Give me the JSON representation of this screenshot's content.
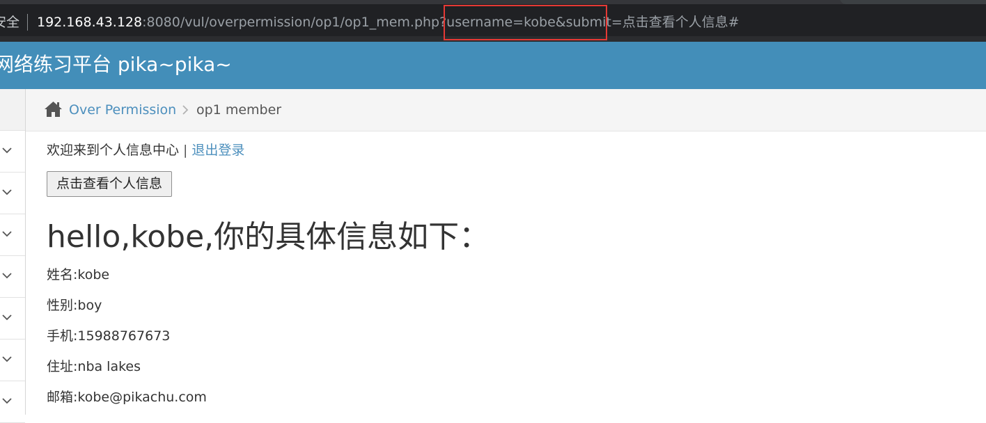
{
  "browser": {
    "security_label": "安全",
    "url_host": "192.168.43.128",
    "url_rest": ":8080/vul/overpermission/op1/op1_mem.php?username=kobe&submit=点击查看个人信息#",
    "highlight_color": "#e53935"
  },
  "header": {
    "brand": "网络练习平台 pika~pika~",
    "background": "#438eb9"
  },
  "sidebar": {
    "items": [
      {
        "icon": "chevron-down-icon"
      },
      {
        "icon": "chevron-down-icon"
      },
      {
        "icon": "chevron-down-icon"
      },
      {
        "icon": "chevron-down-icon"
      },
      {
        "icon": "chevron-down-icon"
      },
      {
        "icon": "chevron-down-icon"
      },
      {
        "icon": "chevron-down-icon"
      }
    ]
  },
  "breadcrumb": {
    "home_icon": "home-icon",
    "link": "Over Permission",
    "current": "op1 member",
    "link_color": "#4c8fbd"
  },
  "main": {
    "welcome_text": "欢迎来到个人信息中心",
    "separator": "|",
    "logout_label": "退出登录",
    "view_button_label": "点击查看个人信息",
    "heading": "hello,kobe,你的具体信息如下：",
    "fields": {
      "name": "姓名:kobe",
      "sex": "性别:boy",
      "phone": "手机:15988767673",
      "address": "住址:nba lakes",
      "email": "邮箱:kobe@pikachu.com"
    }
  }
}
